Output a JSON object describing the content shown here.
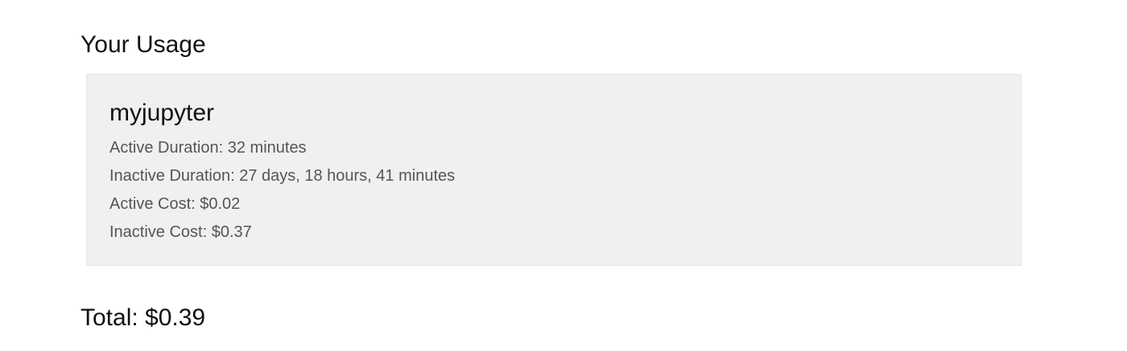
{
  "page": {
    "title": "Your Usage"
  },
  "usage": {
    "server_name": "myjupyter",
    "details": [
      "Active Duration: 32 minutes",
      "Inactive Duration: 27 days, 18 hours, 41 minutes",
      "Active Cost: $0.02",
      "Inactive Cost: $0.37"
    ]
  },
  "summary": {
    "total": "Total: $0.39"
  }
}
